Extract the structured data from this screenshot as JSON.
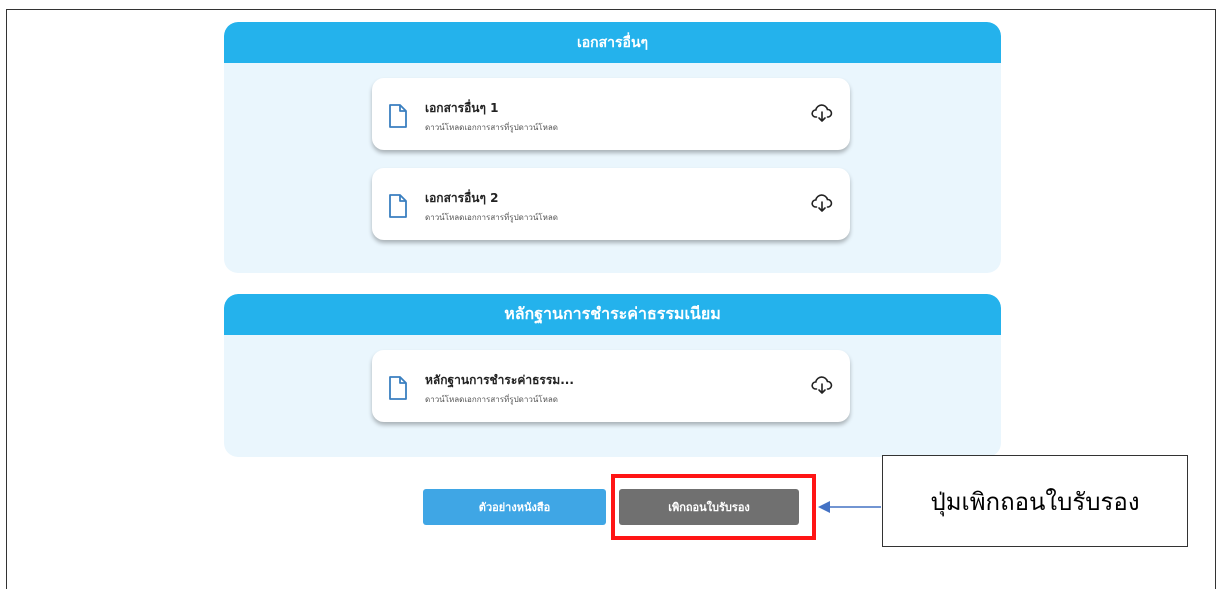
{
  "sections": [
    {
      "title": "เอกสารอื่นๆ",
      "files": [
        {
          "name": "เอกสารอื่นๆ 1",
          "subtitle": "ดาวน์โหลดเอกการสารที่รูปดาวน์โหลด",
          "icon": "file-icon",
          "action_icon": "cloud-download-icon"
        },
        {
          "name": "เอกสารอื่นๆ 2",
          "subtitle": "ดาวน์โหลดเอกการสารที่รูปดาวน์โหลด",
          "icon": "file-icon",
          "action_icon": "cloud-download-icon"
        }
      ]
    },
    {
      "title": "หลักฐานการชำระค่าธรรมเนียม",
      "files": [
        {
          "name": "หลักฐานการชำระค่าธรรม...",
          "subtitle": "ดาวน์โหลดเอกการสารที่รูปดาวน์โหลด",
          "icon": "file-icon",
          "action_icon": "cloud-download-icon"
        }
      ]
    }
  ],
  "buttons": {
    "example_label": "ตัวอย่างหนังสือ",
    "revoke_label": "เพิกถอนใบรับรอง"
  },
  "annotation": {
    "callout_text": "ปุ่มเพิกถอนใบรับรอง"
  },
  "colors": {
    "header_blue": "#24b2ec",
    "section_bg": "#eaf6fd",
    "example_button": "#3fa6e5",
    "revoke_button": "#707070",
    "highlight_red": "#ff1515",
    "arrow_blue": "#4472c4"
  }
}
